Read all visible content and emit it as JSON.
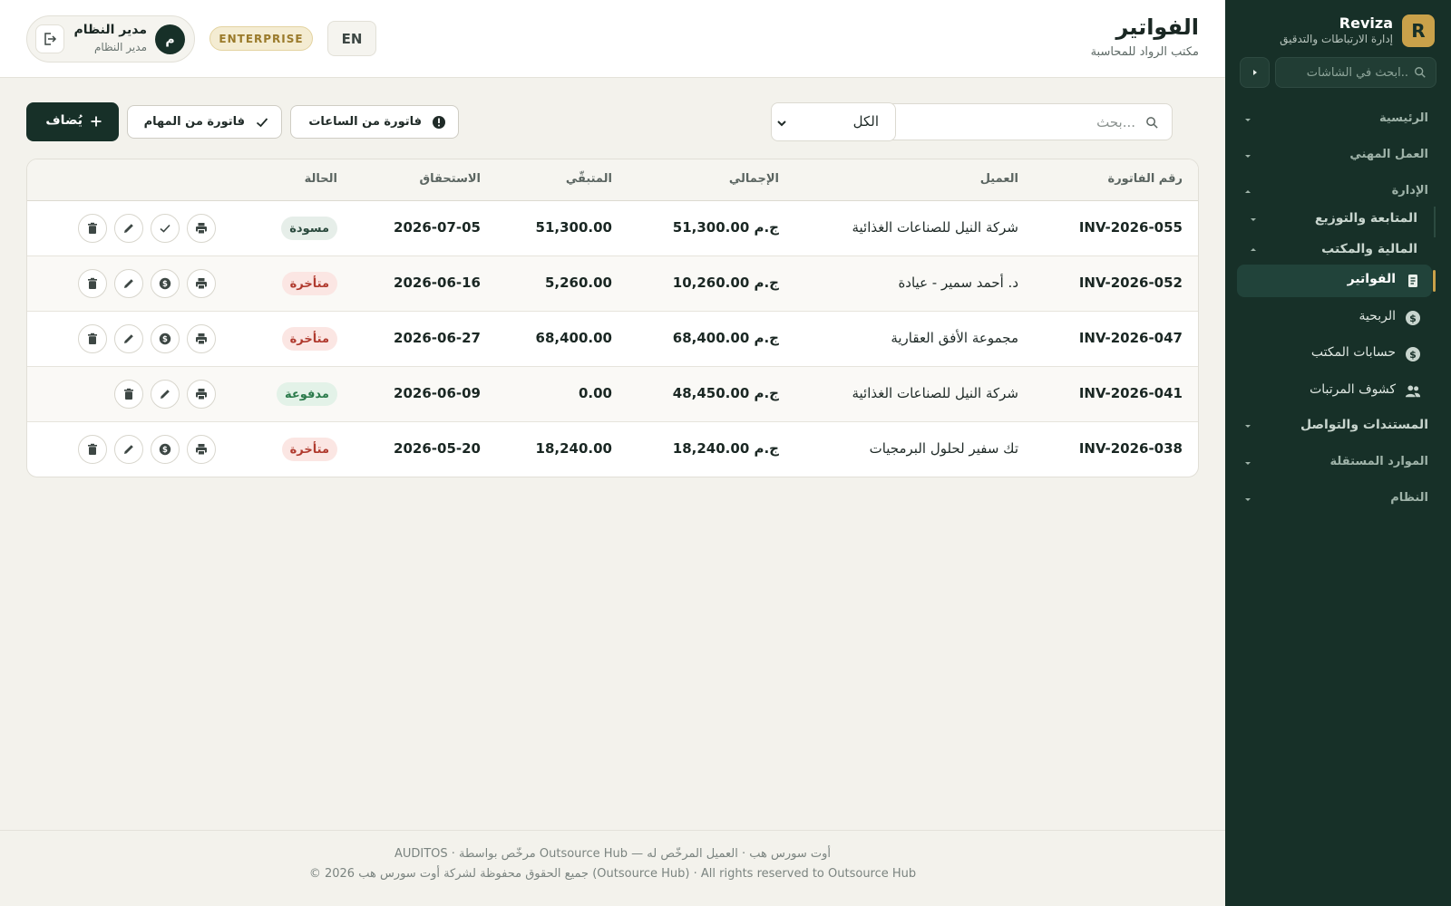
{
  "sidebar": {
    "brand_letter": "R",
    "brand_name": "Reviza",
    "brand_sub": "إدارة الارتباطات والتدقيق",
    "search_placeholder": "ابحث في الشاشات..",
    "sections": {
      "home": "الرئيسية",
      "professional": "العمل المهني",
      "admin": "الإدارة",
      "tracking": "المتابعة والتوزيع",
      "finance": "المالية والمكتب",
      "documents": "المستندات والتواصل",
      "independent": "الموارد المستقلة",
      "system": "النظام"
    },
    "items": [
      {
        "label": "الفواتير",
        "icon": "invoice-icon",
        "active": true
      },
      {
        "label": "الربحية",
        "icon": "dollar-circle-icon",
        "active": false
      },
      {
        "label": "حسابات المكتب",
        "icon": "dollar-circle-icon",
        "active": false
      },
      {
        "label": "كشوف المرتبات",
        "icon": "people-icon",
        "active": false
      }
    ]
  },
  "header": {
    "title": "الفواتير",
    "subtitle": "مكتب الرواد للمحاسبة",
    "user_initial": "م",
    "user_name": "مدير النظام",
    "user_role": "مدير النظام",
    "plan_badge": "ENTERPRISE",
    "lang_button": "EN"
  },
  "toolbar": {
    "search_placeholder": "بحث...",
    "filter_value": "الكل",
    "from_hours_label": "فاتورة من الساعات",
    "from_tasks_label": "فاتورة من المهام",
    "add_label": "يُضاف"
  },
  "table": {
    "headers": {
      "number": "رقم الفاتورة",
      "client": "العميل",
      "total": "الإجمالي",
      "remaining": "المتبقّي",
      "due": "الاستحقاق",
      "status": "الحالة"
    },
    "rows": [
      {
        "number": "INV-2026-055",
        "client": "شركة النيل للصناعات الغذائية",
        "total": "ج.م 51,300.00",
        "remaining": "51,300.00",
        "due": "2026-07-05",
        "status": "مسودة",
        "status_kind": "draft",
        "actions": [
          "print",
          "approve",
          "edit",
          "delete"
        ]
      },
      {
        "number": "INV-2026-052",
        "client": "د. أحمد سمير - عيادة",
        "total": "ج.م 10,260.00",
        "remaining": "5,260.00",
        "due": "2026-06-16",
        "status": "متأخرة",
        "status_kind": "late",
        "actions": [
          "print",
          "payment",
          "edit",
          "delete"
        ]
      },
      {
        "number": "INV-2026-047",
        "client": "مجموعة الأفق العقارية",
        "total": "ج.م 68,400.00",
        "remaining": "68,400.00",
        "due": "2026-06-27",
        "status": "متأخرة",
        "status_kind": "late",
        "actions": [
          "print",
          "payment",
          "edit",
          "delete"
        ]
      },
      {
        "number": "INV-2026-041",
        "client": "شركة النيل للصناعات الغذائية",
        "total": "ج.م 48,450.00",
        "remaining": "0.00",
        "due": "2026-06-09",
        "status": "مدفوعة",
        "status_kind": "paid",
        "actions": [
          "print",
          "edit",
          "delete"
        ]
      },
      {
        "number": "INV-2026-038",
        "client": "تك سفير لحلول البرمجيات",
        "total": "ج.م 18,240.00",
        "remaining": "18,240.00",
        "due": "2026-05-20",
        "status": "متأخرة",
        "status_kind": "late",
        "actions": [
          "print",
          "payment",
          "edit",
          "delete"
        ]
      }
    ]
  },
  "footer": {
    "line1": "AUDITOS · مرخّص بواسطة Outsource Hub — أوت سورس هب · العميل المرخّص له",
    "line2": "© 2026 جميع الحقوق محفوظة لشركة أوت سورس هب (Outsource Hub) · All rights reserved to Outsource Hub"
  },
  "colors": {
    "sidebar_bg": "#173028",
    "accent_gold": "#c9a14a",
    "primary_button": "#173028",
    "late": "#b03a2e",
    "paid": "#2b7a4b"
  }
}
